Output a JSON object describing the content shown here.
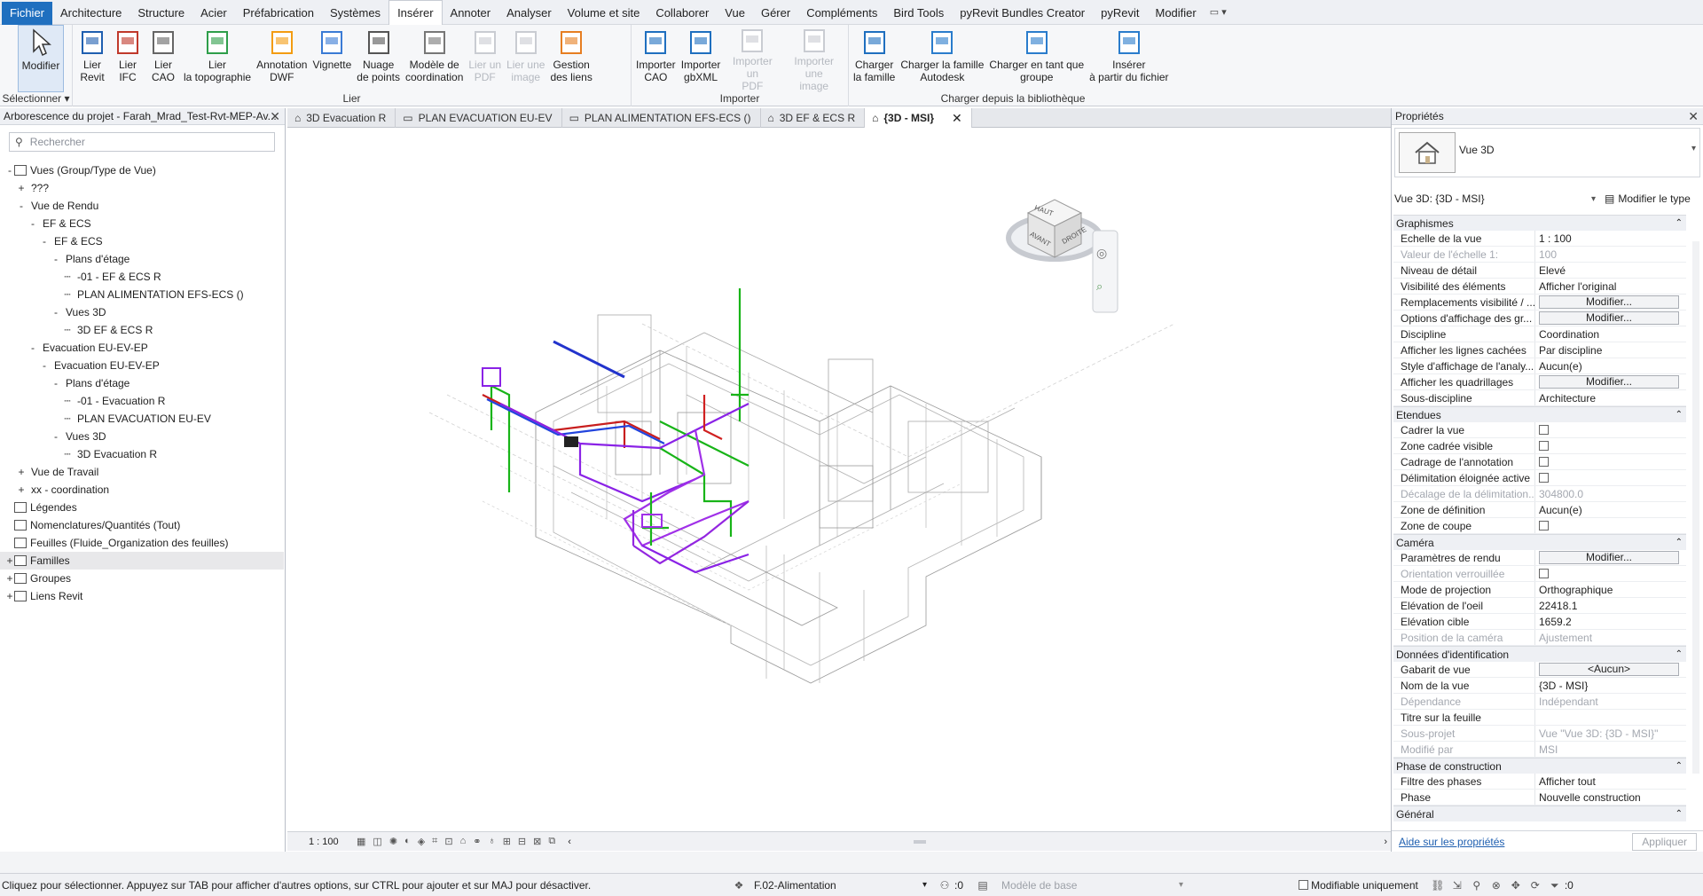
{
  "menu": {
    "items": [
      "Fichier",
      "Architecture",
      "Structure",
      "Acier",
      "Préfabrication",
      "Systèmes",
      "Insérer",
      "Annoter",
      "Analyser",
      "Volume et site",
      "Collaborer",
      "Vue",
      "Gérer",
      "Compléments",
      "Bird Tools",
      "pyRevit Bundles Creator",
      "pyRevit",
      "Modifier"
    ],
    "active": "Insérer"
  },
  "ribbon": {
    "select_panel": {
      "label": "Sélectionner",
      "button": "Modifier"
    },
    "link_panel": {
      "label": "Lier",
      "buttons": [
        "Lier\nRevit",
        "Lier\nIFC",
        "Lier\nCAO",
        "Lier\nla topographie",
        "Annotation\nDWF",
        "Vignette",
        "Nuage\nde points",
        "Modèle de\ncoordination",
        "Lier un\nPDF",
        "Lier une\nimage",
        "Gestion\ndes liens"
      ]
    },
    "import_panel": {
      "label": "Importer",
      "buttons": [
        "Importer\nCAO",
        "Importer\ngbXML",
        "Importer un\nPDF",
        "Importer une\nimage"
      ]
    },
    "library_panel": {
      "label": "Charger depuis la bibliothèque",
      "buttons": [
        "Charger\nla famille",
        "Charger la famille\nAutodesk",
        "Charger en tant que\ngroupe",
        "Insérer\nà partir du fichier"
      ]
    }
  },
  "browser": {
    "title": "Arborescence du projet - Farah_Mrad_Test-Rvt-MEP-Av...",
    "search_placeholder": "Rechercher",
    "tree": [
      {
        "label": "Vues (Group/Type de Vue)",
        "level": 0,
        "toggle": "-"
      },
      {
        "label": "???",
        "level": 1,
        "toggle": "+"
      },
      {
        "label": "Vue de Rendu",
        "level": 1,
        "toggle": "-"
      },
      {
        "label": "EF & ECS",
        "level": 2,
        "toggle": "-"
      },
      {
        "label": "EF & ECS",
        "level": 3,
        "toggle": "-"
      },
      {
        "label": "Plans d'étage",
        "level": 4,
        "toggle": "-"
      },
      {
        "label": "-01 - EF & ECS R",
        "level": 5,
        "toggle": ""
      },
      {
        "label": "PLAN ALIMENTATION EFS-ECS ()",
        "level": 5,
        "toggle": ""
      },
      {
        "label": "Vues 3D",
        "level": 4,
        "toggle": "-"
      },
      {
        "label": "3D EF & ECS R",
        "level": 5,
        "toggle": ""
      },
      {
        "label": "Evacuation EU-EV-EP",
        "level": 2,
        "toggle": "-"
      },
      {
        "label": "Evacuation EU-EV-EP",
        "level": 3,
        "toggle": "-"
      },
      {
        "label": "Plans d'étage",
        "level": 4,
        "toggle": "-"
      },
      {
        "label": "-01 - Evacuation R",
        "level": 5,
        "toggle": ""
      },
      {
        "label": "PLAN EVACUATION EU-EV",
        "level": 5,
        "toggle": ""
      },
      {
        "label": "Vues 3D",
        "level": 4,
        "toggle": "-"
      },
      {
        "label": "3D Evacuation R",
        "level": 5,
        "toggle": ""
      },
      {
        "label": "Vue de Travail",
        "level": 1,
        "toggle": "+"
      },
      {
        "label": "xx - coordination",
        "level": 1,
        "toggle": "+"
      },
      {
        "label": "Légendes",
        "level": 0,
        "toggle": ""
      },
      {
        "label": "Nomenclatures/Quantités (Tout)",
        "level": 0,
        "toggle": ""
      },
      {
        "label": "Feuilles (Fluide_Organization des feuilles)",
        "level": 0,
        "toggle": ""
      },
      {
        "label": "Familles",
        "level": 0,
        "toggle": "+",
        "highlight": true
      },
      {
        "label": "Groupes",
        "level": 0,
        "toggle": "+"
      },
      {
        "label": "Liens Revit",
        "level": 0,
        "toggle": "+"
      }
    ]
  },
  "tabs": [
    {
      "label": "3D Evacuation R"
    },
    {
      "label": "PLAN EVACUATION EU-EV"
    },
    {
      "label": "PLAN ALIMENTATION EFS-ECS ()"
    },
    {
      "label": "3D EF & ECS R"
    },
    {
      "label": "{3D - MSI}",
      "active": true
    }
  ],
  "viewcube": {
    "top": "HAUT",
    "front": "AVANT",
    "right": "DROITE"
  },
  "view_controls": {
    "scale": "1 : 100"
  },
  "properties": {
    "title": "Propriétés",
    "type_name": "Vue 3D",
    "instance_selector": "Vue 3D: {3D - MSI}",
    "edit_type": "Modifier le type",
    "groups": [
      {
        "name": "Graphismes",
        "rows": [
          {
            "n": "Echelle de la vue",
            "v": "1 : 100"
          },
          {
            "n": "Valeur de l'échelle    1:",
            "v": "100",
            "dis": true
          },
          {
            "n": "Niveau de détail",
            "v": "Elevé"
          },
          {
            "n": "Visibilité des éléments",
            "v": "Afficher l'original"
          },
          {
            "n": "Remplacements visibilité / ...",
            "v": "Modifier...",
            "btn": true
          },
          {
            "n": "Options d'affichage des gr...",
            "v": "Modifier...",
            "btn": true
          },
          {
            "n": "Discipline",
            "v": "Coordination"
          },
          {
            "n": "Afficher les lignes cachées",
            "v": "Par discipline"
          },
          {
            "n": "Style d'affichage de l'analy...",
            "v": "Aucun(e)"
          },
          {
            "n": "Afficher les quadrillages",
            "v": "Modifier...",
            "btn": true
          },
          {
            "n": "Sous-discipline",
            "v": "Architecture"
          }
        ]
      },
      {
        "name": "Etendues",
        "rows": [
          {
            "n": "Cadrer la vue",
            "v": "",
            "chk": true
          },
          {
            "n": "Zone cadrée visible",
            "v": "",
            "chk": true
          },
          {
            "n": "Cadrage de l'annotation",
            "v": "",
            "chk": true
          },
          {
            "n": "Délimitation éloignée active",
            "v": "",
            "chk": true
          },
          {
            "n": "Décalage de la délimitation...",
            "v": "304800.0",
            "dis": true
          },
          {
            "n": "Zone de définition",
            "v": "Aucun(e)"
          },
          {
            "n": "Zone de coupe",
            "v": "",
            "chk": true
          }
        ]
      },
      {
        "name": "Caméra",
        "rows": [
          {
            "n": "Paramètres de rendu",
            "v": "Modifier...",
            "btn": true
          },
          {
            "n": "Orientation verrouillée",
            "v": "",
            "chk": true,
            "dis": true
          },
          {
            "n": "Mode de projection",
            "v": "Orthographique"
          },
          {
            "n": "Elévation de l'oeil",
            "v": "22418.1"
          },
          {
            "n": "Elévation cible",
            "v": "1659.2"
          },
          {
            "n": "Position de la caméra",
            "v": "Ajustement",
            "dis": true
          }
        ]
      },
      {
        "name": "Données d'identification",
        "rows": [
          {
            "n": "Gabarit de vue",
            "v": "<Aucun>",
            "btn": true
          },
          {
            "n": "Nom de la vue",
            "v": "{3D - MSI}"
          },
          {
            "n": "Dépendance",
            "v": "Indépendant",
            "dis": true
          },
          {
            "n": "Titre sur la feuille",
            "v": ""
          },
          {
            "n": "Sous-projet",
            "v": "Vue \"Vue 3D: {3D - MSI}\"",
            "dis": true
          },
          {
            "n": "Modifié par",
            "v": "MSI",
            "dis": true
          }
        ]
      },
      {
        "name": "Phase de construction",
        "rows": [
          {
            "n": "Filtre des phases",
            "v": "Afficher tout"
          },
          {
            "n": "Phase",
            "v": "Nouvelle construction"
          }
        ]
      },
      {
        "name": "Général",
        "rows": []
      }
    ],
    "help_link": "Aide sur les propriétés",
    "apply": "Appliquer"
  },
  "status": {
    "hint": "Cliquez pour sélectionner. Appuyez sur TAB pour afficher d'autres options, sur CTRL pour ajouter et sur MAJ pour désactiver.",
    "workset": "F.02-Alimentation",
    "counter": ":0",
    "design_option": "Modèle de base",
    "editable_only": "Modifiable uniquement",
    "filter_count": ":0"
  }
}
